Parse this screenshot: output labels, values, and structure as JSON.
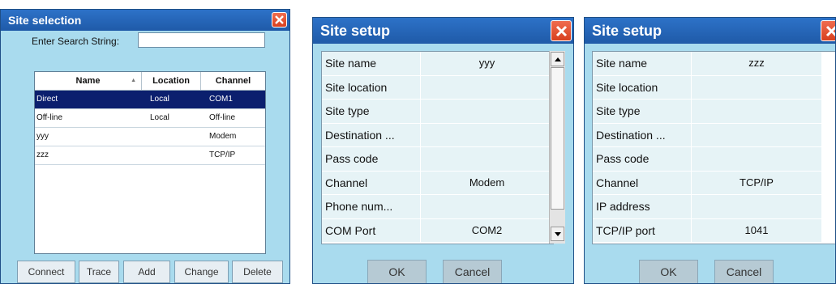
{
  "site_selection": {
    "title": "Site selection",
    "search_label": "Enter Search String:",
    "search_value": "",
    "columns": [
      "Name",
      "Location",
      "Channel"
    ],
    "rows": [
      {
        "name": "Direct",
        "location": "Local",
        "channel": "COM1",
        "selected": true
      },
      {
        "name": "Off-line",
        "location": "Local",
        "channel": "Off-line",
        "selected": false
      },
      {
        "name": "yyy",
        "location": "",
        "channel": "Modem",
        "selected": false
      },
      {
        "name": "zzz",
        "location": "",
        "channel": "TCP/IP",
        "selected": false
      }
    ],
    "buttons": {
      "connect": "Connect",
      "trace": "Trace",
      "add": "Add",
      "change": "Change",
      "delete": "Delete"
    }
  },
  "setup1": {
    "title": "Site setup",
    "rows": [
      {
        "label": "Site name",
        "value": "yyy"
      },
      {
        "label": "Site location",
        "value": ""
      },
      {
        "label": "Site type",
        "value": ""
      },
      {
        "label": "Destination ...",
        "value": ""
      },
      {
        "label": "Pass code",
        "value": ""
      },
      {
        "label": "Channel",
        "value": "Modem"
      },
      {
        "label": "Phone num...",
        "value": ""
      },
      {
        "label": "COM Port",
        "value": "COM2"
      }
    ],
    "ok": "OK",
    "cancel": "Cancel"
  },
  "setup2": {
    "title": "Site setup",
    "rows": [
      {
        "label": "Site name",
        "value": "zzz"
      },
      {
        "label": "Site location",
        "value": ""
      },
      {
        "label": "Site type",
        "value": ""
      },
      {
        "label": "Destination ...",
        "value": ""
      },
      {
        "label": "Pass code",
        "value": ""
      },
      {
        "label": "Channel",
        "value": "TCP/IP"
      },
      {
        "label": "IP address",
        "value": ""
      },
      {
        "label": "TCP/IP port",
        "value": "1041"
      }
    ],
    "ok": "OK",
    "cancel": "Cancel"
  },
  "colors": {
    "title_bar": "#2469c0",
    "window_bg": "#a9dbee",
    "selection": "#0b1f6e",
    "close": "#e0502c"
  }
}
